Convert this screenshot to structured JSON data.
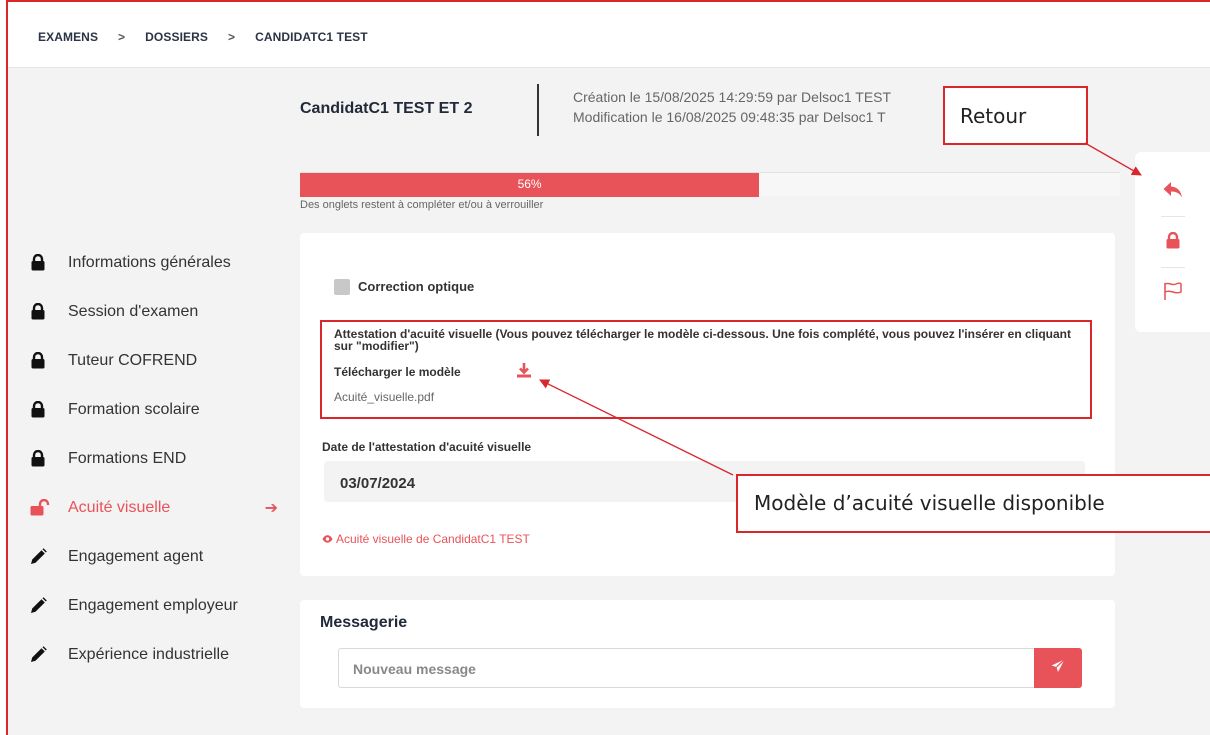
{
  "breadcrumb": {
    "items": [
      "EXAMENS",
      "DOSSIERS",
      "CANDIDATC1 TEST"
    ],
    "separator": ">"
  },
  "header": {
    "title": "CandidatC1 TEST ET 2",
    "creation": "Création le 15/08/2025 14:29:59 par Delsoc1 TEST",
    "modification": "Modification le 16/08/2025 09:48:35 par Delsoc1 T"
  },
  "progress": {
    "value_percent": 56,
    "label": "56%",
    "note": "Des onglets restent à compléter et/ou à verrouiller"
  },
  "sidebar": {
    "items": [
      {
        "label": "Informations générales",
        "icon": "lock-icon",
        "active": false
      },
      {
        "label": "Session d'examen",
        "icon": "lock-icon",
        "active": false
      },
      {
        "label": "Tuteur COFREND",
        "icon": "lock-icon",
        "active": false
      },
      {
        "label": "Formation scolaire",
        "icon": "lock-icon",
        "active": false
      },
      {
        "label": "Formations END",
        "icon": "lock-icon",
        "active": false
      },
      {
        "label": "Acuité visuelle",
        "icon": "unlock-icon",
        "active": true
      },
      {
        "label": "Engagement agent",
        "icon": "pencil-icon",
        "active": false
      },
      {
        "label": "Engagement employeur",
        "icon": "pencil-icon",
        "active": false
      },
      {
        "label": "Expérience industrielle",
        "icon": "pencil-icon",
        "active": false
      }
    ],
    "arrow": "➔"
  },
  "form": {
    "checkbox_label": "Correction optique",
    "attestation_title": "Attestation d'acuité visuelle (Vous pouvez télécharger le modèle ci-dessous. Une fois complété, vous pouvez l'insérer en cliquant sur \"modifier\")",
    "download_label": "Télécharger le modèle",
    "file_name": "Acuité_visuelle.pdf",
    "date_label": "Date de l'attestation d'acuité visuelle",
    "date_value": "03/07/2024",
    "view_link": "Acuité visuelle de CandidatC1 TEST"
  },
  "messaging": {
    "title": "Messagerie",
    "placeholder": "Nouveau message"
  },
  "annotations": {
    "retour": "Retour",
    "modele": "Modèle d’acuité visuelle disponible"
  },
  "colors": {
    "accent": "#e8535a",
    "annotation": "#d9272e"
  }
}
